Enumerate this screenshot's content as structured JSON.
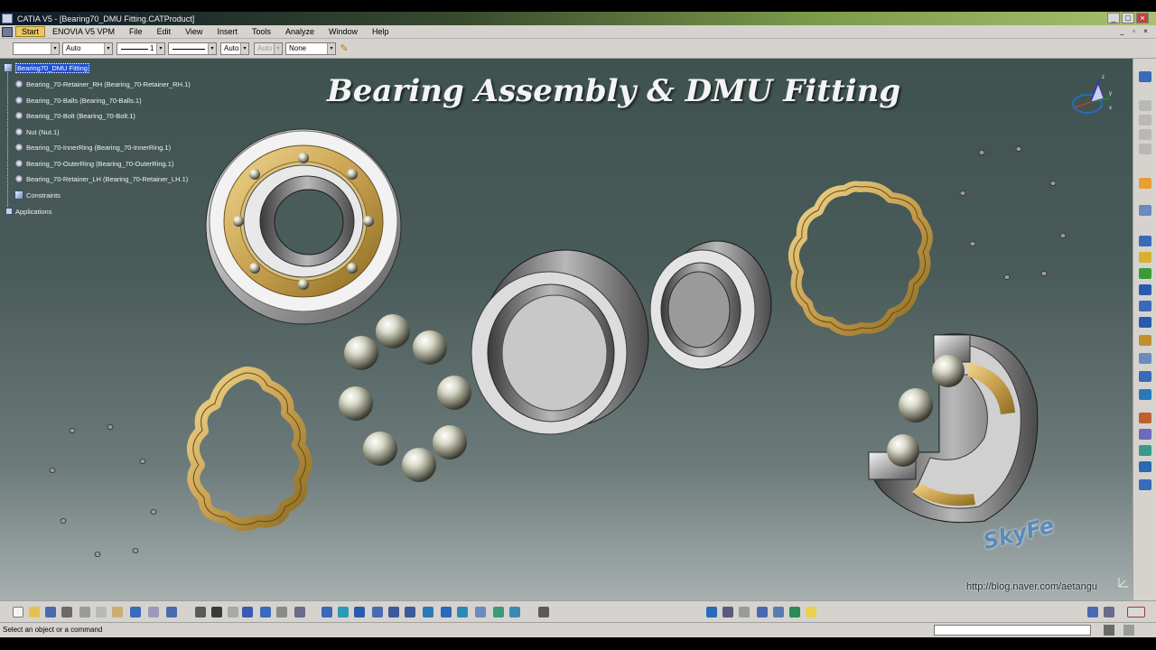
{
  "window": {
    "title": "CATIA V5 - [Bearing70_DMU Fitting.CATProduct]",
    "buttons": {
      "minimize": "_",
      "restore": "□",
      "close": "×"
    }
  },
  "menu": {
    "items": [
      {
        "label": "Start"
      },
      {
        "label": "ENOVIA V5 VPM"
      },
      {
        "label": "File"
      },
      {
        "label": "Edit"
      },
      {
        "label": "View"
      },
      {
        "label": "Insert"
      },
      {
        "label": "Tools"
      },
      {
        "label": "Analyze"
      },
      {
        "label": "Window"
      },
      {
        "label": "Help"
      }
    ],
    "mdi_buttons": {
      "minimize": "_",
      "restore": "▫",
      "close": "×"
    }
  },
  "properties_toolbar": {
    "color": "",
    "transparency": "Auto",
    "line_thickness": "1",
    "linetype": "",
    "point_symbol": "Auto",
    "layer_disabled": "Auto",
    "layer": "None",
    "combo_arrow": "▾"
  },
  "spec_tree": {
    "root": "Bearing70_DMU Fitting",
    "children": [
      {
        "label": "Bearing_70-Retainer_RH (Bearing_70-Retainer_RH.1)"
      },
      {
        "label": "Bearing_70-Balls (Bearing_70-Balls.1)"
      },
      {
        "label": "Bearing_70-Bolt (Bearing_70-Bolt.1)"
      },
      {
        "label": "Nut (Nut.1)"
      },
      {
        "label": "Bearing_70-InnerRing (Bearing_70-InnerRing.1)"
      },
      {
        "label": "Bearing_70-OuterRing (Bearing_70-OuterRing.1)"
      },
      {
        "label": "Bearing_70-Retainer_LH (Bearing_70-Retainer_LH.1)"
      },
      {
        "label": "Constraints"
      }
    ],
    "applications": "Applications"
  },
  "viewport": {
    "overlay_title": "Bearing Assembly & DMU Fitting",
    "compass_axes": {
      "x": "x",
      "y": "y",
      "z": "z"
    },
    "watermark_logo": "SkyFe",
    "watermark_url": "http://blog.naver.com/aetangu"
  },
  "status_bar": {
    "message": "Select an object or a command"
  },
  "colors": {
    "brass": "#c8a050",
    "steel": "#c4c4c4",
    "viewport_top": "#3e5250",
    "viewport_bottom": "#a8b0b0",
    "selection": "#2050d0"
  },
  "icons": {
    "bottom_toolbar": [
      "new-icon",
      "open-icon",
      "save-icon",
      "print-icon",
      "cut-icon",
      "copy-icon",
      "paste-icon",
      "undo-icon",
      "redo-icon",
      "whats-this-icon",
      "formula-icon",
      "comment-icon",
      "measure-icon",
      "catalog-icon",
      "product-structure-icon",
      "fly-mode-icon",
      "fit-all-icon",
      "pan-icon",
      "rotate-icon",
      "zoom-in-icon",
      "zoom-out-icon",
      "normal-view-icon",
      "quick-view-icon",
      "view-mode-icon",
      "hide-show-icon",
      "swap-visible-icon",
      "camera-icon",
      "compass-tool-icon",
      "reset-icon",
      "move-icon",
      "zoom-area-icon",
      "clash-icon",
      "section-icon",
      "annotations-icon"
    ],
    "right_toolbar": [
      "workbench-icon",
      "select-icon",
      "manipulation-icon",
      "snap-icon",
      "explode-icon",
      "clash-analysis-icon",
      "distance-icon",
      "band-analysis-icon",
      "fitting-icon",
      "track-icon",
      "sequence-icon",
      "edit-simulation-icon",
      "mechanism-icon",
      "replay-icon",
      "swept-volume-icon",
      "compare-icon",
      "group-icon",
      "scene-icon",
      "publish-icon",
      "enovia-icon"
    ]
  }
}
